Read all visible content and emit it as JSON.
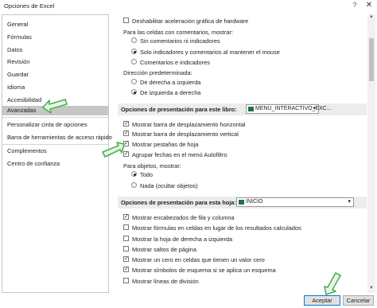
{
  "window": {
    "title": "Opciones de Excel",
    "help_label": "?",
    "close_label": "✕"
  },
  "sidebar": {
    "items": [
      {
        "label": "General"
      },
      {
        "label": "Fórmulas"
      },
      {
        "label": "Datos"
      },
      {
        "label": "Revisión"
      },
      {
        "label": "Guardar"
      },
      {
        "label": "Idioma"
      },
      {
        "label": "Accesibilidad"
      },
      {
        "label": "Avanzadas"
      },
      {
        "label": "Personalizar cinta de opciones"
      },
      {
        "label": "Barra de herramientas de acceso rápido"
      },
      {
        "label": "Complementos"
      },
      {
        "label": "Centro de confianza"
      }
    ],
    "selected": "Avanzadas"
  },
  "content": {
    "hw_accel": {
      "label": "Deshabilitar aceleración gráfica de hardware",
      "checked": false
    },
    "comments_heading": "Para las celdas con comentarios, mostrar:",
    "comments_options": [
      {
        "label": "Sin comentarios ni indicadores",
        "selected": false
      },
      {
        "label": "Solo indicadores y comentarios al mantener el mouse",
        "selected": true
      },
      {
        "label": "Comentarios e indicadores",
        "selected": false
      }
    ],
    "direction_heading": "Dirección predeterminada:",
    "direction_options": [
      {
        "label": "De derecha a izquierda",
        "selected": false
      },
      {
        "label": "De izquierda a derecha",
        "selected": true
      }
    ],
    "book_section": {
      "title": "Opciones de presentación para este libro:",
      "combo_value": "MENU_INTERACTIVO_EXC..."
    },
    "book_options": [
      {
        "label": "Mostrar barra de desplazamiento horizontal",
        "checked": true
      },
      {
        "label": "Mostrar barra de desplazamiento vertical",
        "checked": true
      },
      {
        "label": "Mostrar pestañas de hoja",
        "checked": true
      },
      {
        "label": "Agrupar fechas en el menú Autofiltro",
        "checked": true
      }
    ],
    "objects_heading": "Para objetos, mostrar:",
    "objects_options": [
      {
        "label": "Todo",
        "selected": true
      },
      {
        "label": "Nada (ocultar objetos)",
        "selected": false
      }
    ],
    "sheet_section": {
      "title": "Opciones de presentación para esta hoja:",
      "combo_value": "INICIO"
    },
    "sheet_options": [
      {
        "label": "Mostrar encabezados de fila y columna",
        "checked": true
      },
      {
        "label": "Mostrar fórmulas en celdas en lugar de los resultados calculados",
        "checked": false
      },
      {
        "label": "Mostrar la hoja de derecha a izquierda",
        "checked": false
      },
      {
        "label": "Mostrar saltos de página",
        "checked": false
      },
      {
        "label": "Mostrar un cero en celdas que tienen un valor cero",
        "checked": true
      },
      {
        "label": "Mostrar símbolos de esquema si se aplica un esquema",
        "checked": true
      },
      {
        "label": "Mostrar líneas de división",
        "checked": false
      }
    ]
  },
  "footer": {
    "ok_label": "Aceptar",
    "cancel_label": "Cancelar"
  },
  "colors": {
    "arrow": "#4caf50",
    "accent": "#0078d7",
    "excel_green": "#1f7244"
  },
  "icons": [
    "question-icon",
    "close-icon",
    "excel-icon",
    "chevron-down-icon",
    "arrow-up-icon",
    "arrow-down-icon",
    "pointer-arrow-icon"
  ]
}
